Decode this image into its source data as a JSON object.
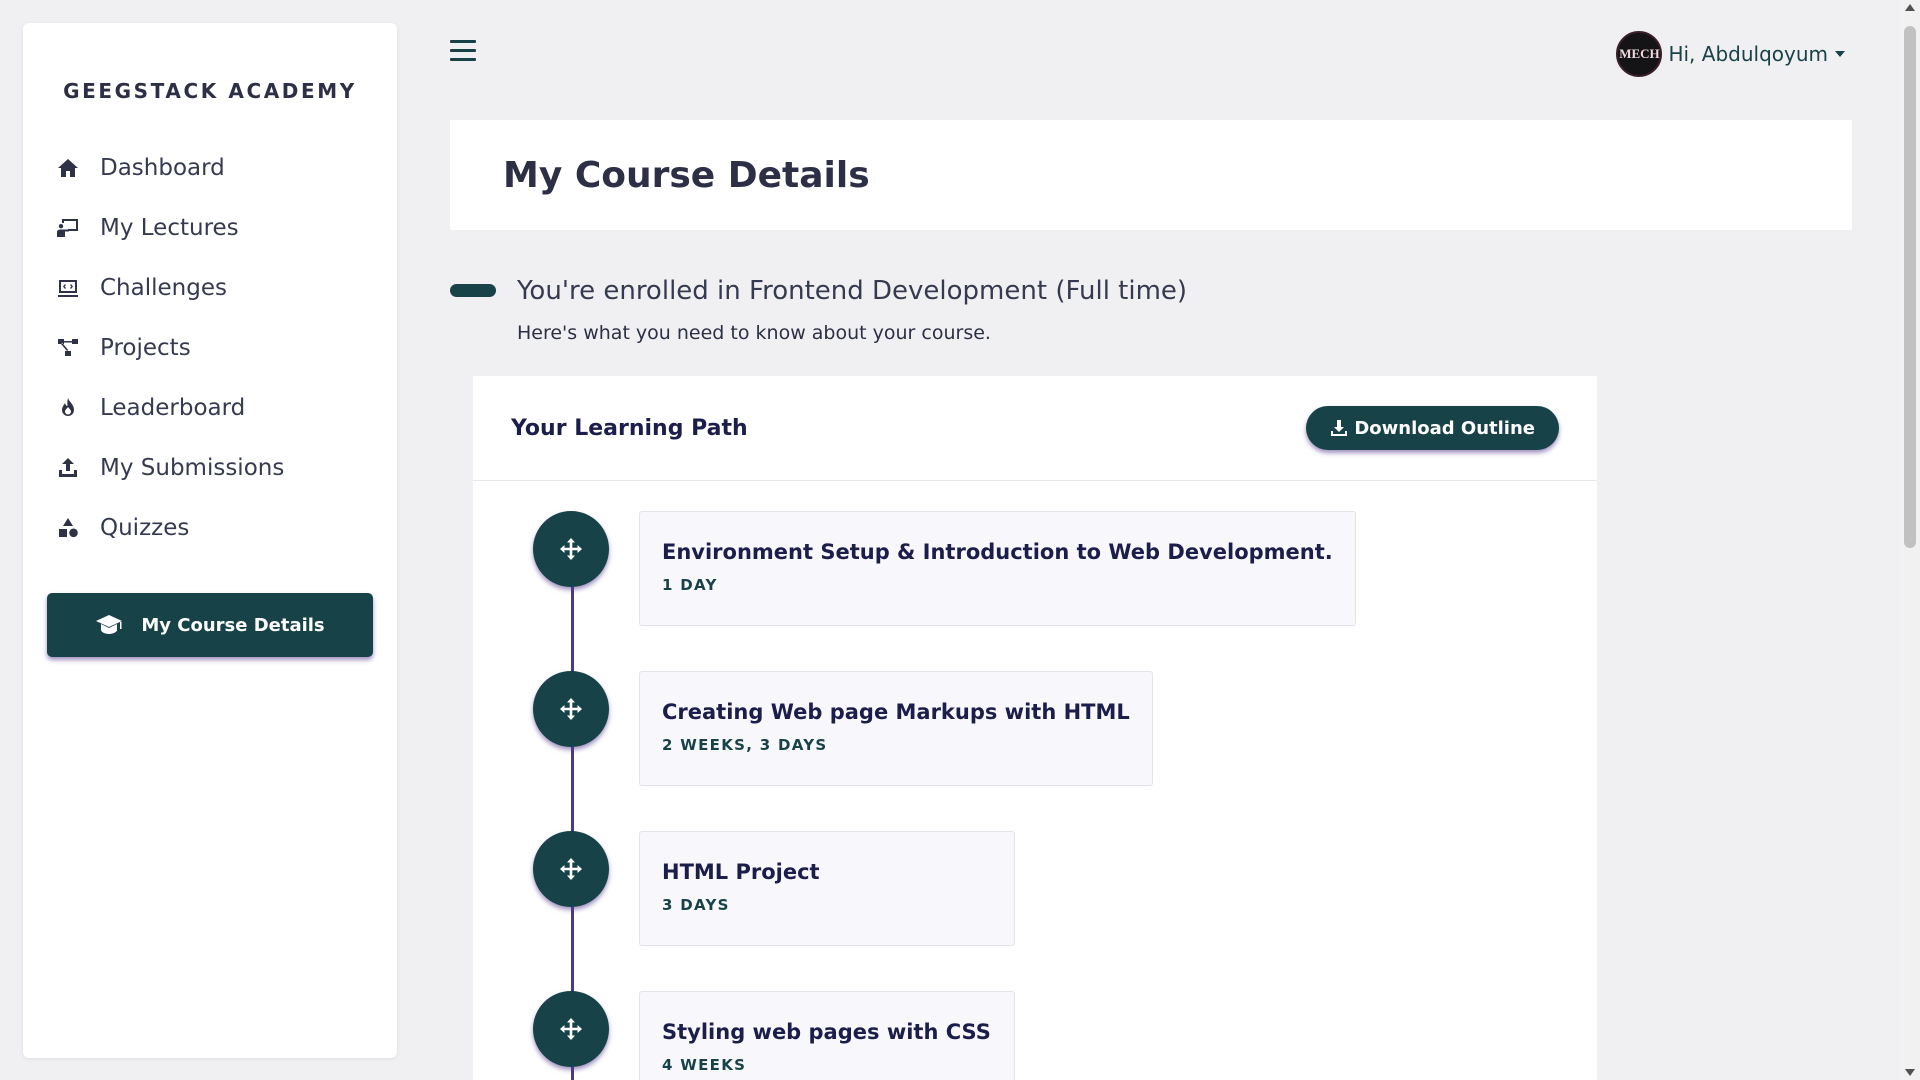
{
  "sidebar": {
    "brand": "GEEGSTACK ACADEMY",
    "items": [
      {
        "label": "Dashboard",
        "icon": "home-icon"
      },
      {
        "label": "My Lectures",
        "icon": "lecture-icon"
      },
      {
        "label": "Challenges",
        "icon": "challenge-icon"
      },
      {
        "label": "Projects",
        "icon": "projects-icon"
      },
      {
        "label": "Leaderboard",
        "icon": "fire-icon"
      },
      {
        "label": "My Submissions",
        "icon": "upload-icon"
      },
      {
        "label": "Quizzes",
        "icon": "shapes-icon"
      }
    ],
    "active_button": {
      "label": "My Course Details",
      "icon": "graduation-cap-icon"
    }
  },
  "topbar": {
    "menu_icon": "hamburger-icon",
    "greeting": "Hi, Abdulqoyum",
    "avatar_text": "MECH"
  },
  "header": {
    "title": "My Course Details"
  },
  "enrollment": {
    "title": "You're enrolled in Frontend Development (Full time)",
    "subtitle": "Here's what you need to know about your course."
  },
  "learning_path": {
    "title": "Your Learning Path",
    "download_label": "Download Outline",
    "steps": [
      {
        "title": "Environment Setup & Introduction to Web Development.",
        "duration": "1 DAY"
      },
      {
        "title": "Creating Web page Markups with HTML",
        "duration": "2 WEEKS, 3 DAYS"
      },
      {
        "title": "HTML Project",
        "duration": "3 DAYS"
      },
      {
        "title": "Styling web pages with CSS",
        "duration": "4 WEEKS"
      }
    ]
  },
  "colors": {
    "accent": "#174348",
    "timeline": "#4a3a88",
    "background": "#f0f0f2",
    "heading": "#1b1e4a"
  }
}
